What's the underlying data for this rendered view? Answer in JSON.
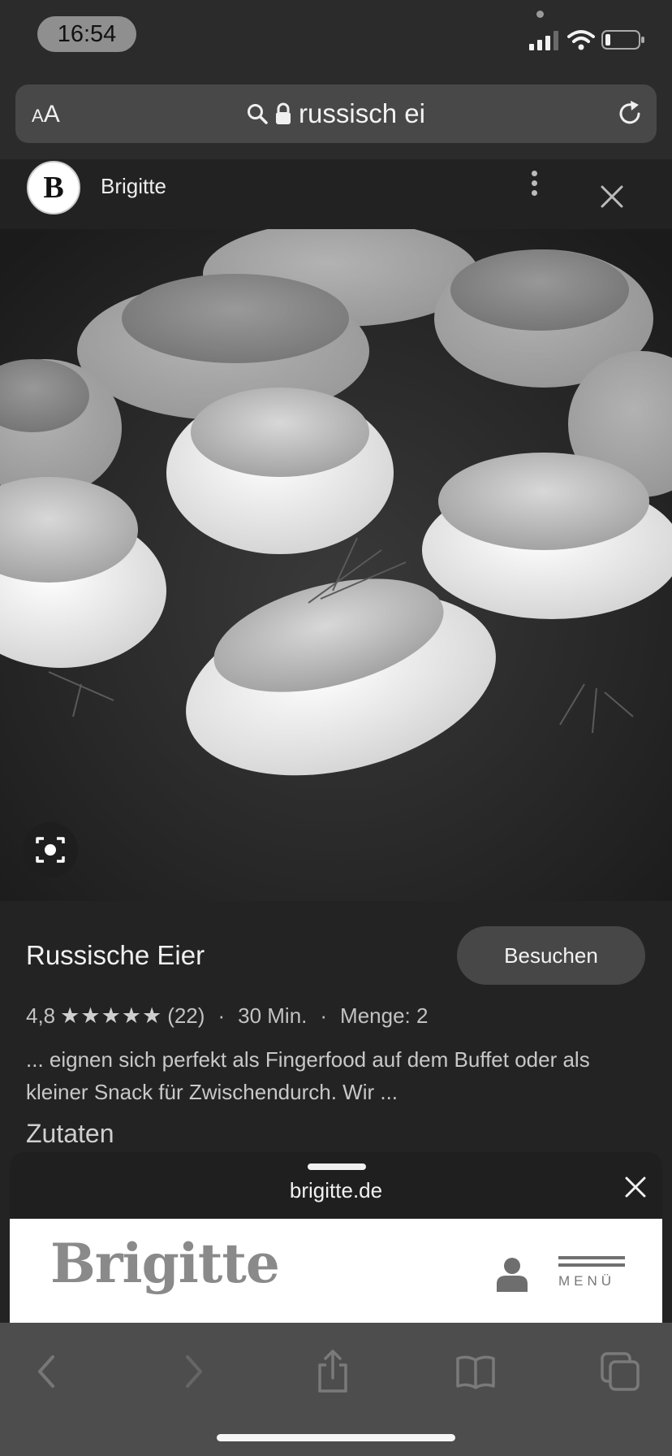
{
  "status_bar": {
    "time": "16:54"
  },
  "url_bar": {
    "text_size_label_small": "A",
    "text_size_label_large": "A",
    "url": "russisch ei"
  },
  "source": {
    "logo_letter": "B",
    "name": "Brigitte"
  },
  "result": {
    "title": "Russische Eier",
    "visit_label": "Besuchen",
    "rating": "4,8",
    "stars": "★★★★★",
    "rating_fraction": 1.0,
    "review_count": "(22)",
    "time": "30 Min.",
    "yield": "Menge: 2",
    "snippet": "... eignen sich perfekt als Fingerfood auf dem Buffet oder als kleiner Snack für Zwischendurch. Wir ...",
    "section_heading": "Zutaten"
  },
  "sheet": {
    "domain": "brigitte.de",
    "brand": "Brigitte",
    "menu_label": "MENÜ"
  },
  "toolbar": {
    "items": [
      "back-icon",
      "forward-icon",
      "share-icon",
      "bookmarks-icon",
      "tabs-icon"
    ]
  },
  "colors": {
    "background": "#232323",
    "url_bar": "#484848",
    "button": "#474747",
    "toolbar": "#4d4d4d"
  }
}
